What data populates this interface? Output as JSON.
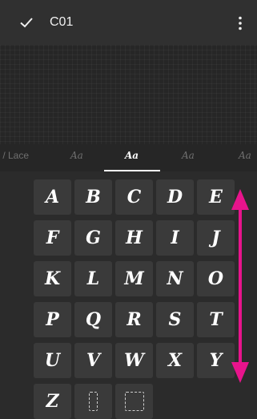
{
  "toolbar": {
    "title": "C01"
  },
  "tabs": [
    {
      "label": "r / Lace"
    },
    {
      "label": "Aa"
    },
    {
      "label": "Aa",
      "active": true
    },
    {
      "label": "Aa"
    },
    {
      "label": "Aa"
    }
  ],
  "keys": [
    "A",
    "B",
    "C",
    "D",
    "E",
    "F",
    "G",
    "H",
    "I",
    "J",
    "K",
    "L",
    "M",
    "N",
    "O",
    "P",
    "Q",
    "R",
    "S",
    "T",
    "U",
    "V",
    "W",
    "X",
    "Y",
    "Z",
    "",
    ""
  ],
  "colors": {
    "toolbar_bg": "#303030",
    "background": "#2b2b2b",
    "key_bg": "#3a3a3a",
    "accent_arrow": "#e8148c"
  },
  "icons": {
    "confirm": "check-icon",
    "menu": "more-vert-icon",
    "scroll": "double-arrow-icon"
  }
}
